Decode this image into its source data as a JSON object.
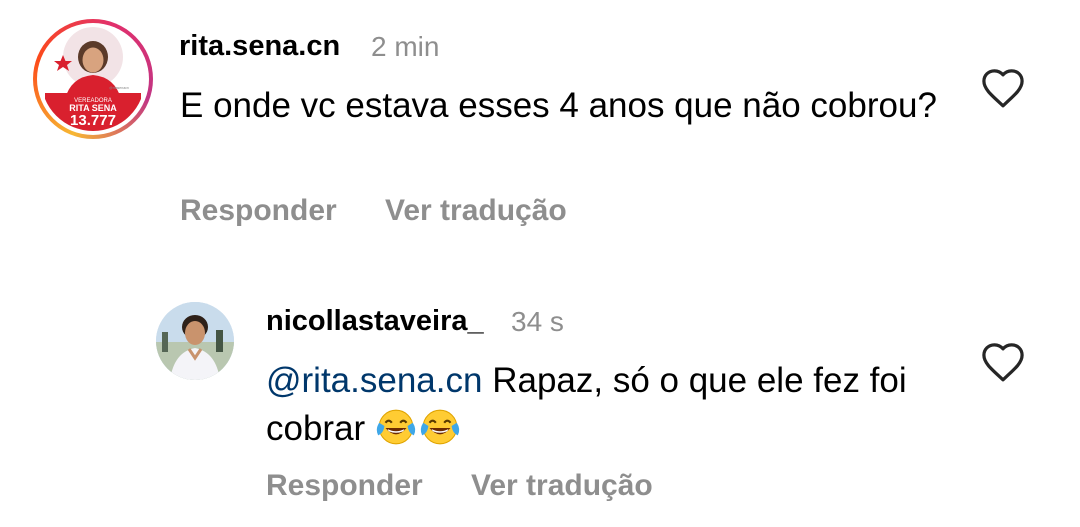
{
  "comment": {
    "username": "rita.sena.cn",
    "time": "2 min",
    "text": "E onde vc estava esses 4 anos que não cobrou?",
    "reply_label": "Responder",
    "translate_label": "Ver tradução",
    "avatar": {
      "label_top": "VEREADORA",
      "label_name": "RITA SENA",
      "label_number": "13.777",
      "label_handle": "@ritasenacn"
    }
  },
  "reply": {
    "username": "nicollastaveira_",
    "time": "34 s",
    "mention": "@rita.sena.cn",
    "text": "Rapaz, só o que ele fez foi cobrar",
    "emojis": [
      "face-with-tears-of-joy",
      "face-with-tears-of-joy"
    ],
    "reply_label": "Responder",
    "translate_label": "Ver tradução"
  },
  "icons": {
    "like": "heart-outline-icon",
    "emoji": "face-with-tears-of-joy"
  },
  "colors": {
    "secondary_text": "#8e8e8e",
    "mention": "#00376b",
    "ring_gradient": [
      "#f7b733",
      "#fc4a1a",
      "#e1306c",
      "#c13584"
    ],
    "campaign_red": "#d9202e"
  }
}
